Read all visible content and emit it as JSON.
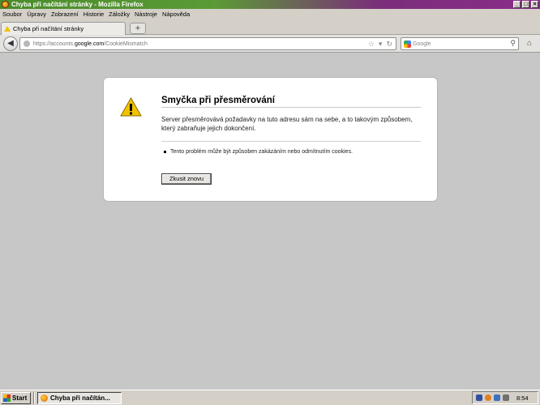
{
  "window": {
    "title": "Chyba při načítání stránky - Mozilla Firefox",
    "buttons": [
      "_",
      "□",
      "×"
    ]
  },
  "menu": {
    "items": [
      "Soubor",
      "Úpravy",
      "Zobrazení",
      "Historie",
      "Záložky",
      "Nástroje",
      "Nápověda"
    ]
  },
  "tabs": {
    "active_label": "Chyba při načítání stránky",
    "new_tab_symbol": "+"
  },
  "nav": {
    "url_prefix": "https://accounts.",
    "url_host": "google.com",
    "url_path": "/CookieMismatch",
    "search_placeholder": "Google"
  },
  "error": {
    "title": "Smyčka při přesměrování",
    "description": "Server přesměrovává požadavky na tuto adresu sám na sebe, a to takovým způsobem, který zabraňuje jejich dokončení.",
    "bullet": "Tento problém může být způsoben zakázáním nebo odmítnutím cookies.",
    "retry_label": "Zkusit znovu"
  },
  "taskbar": {
    "start_label": "Start",
    "task_label": "Chyba při načítán...",
    "clock": "8:54"
  },
  "colors": {
    "warning": "#f2c200",
    "page_bg": "#c7c7c7"
  }
}
